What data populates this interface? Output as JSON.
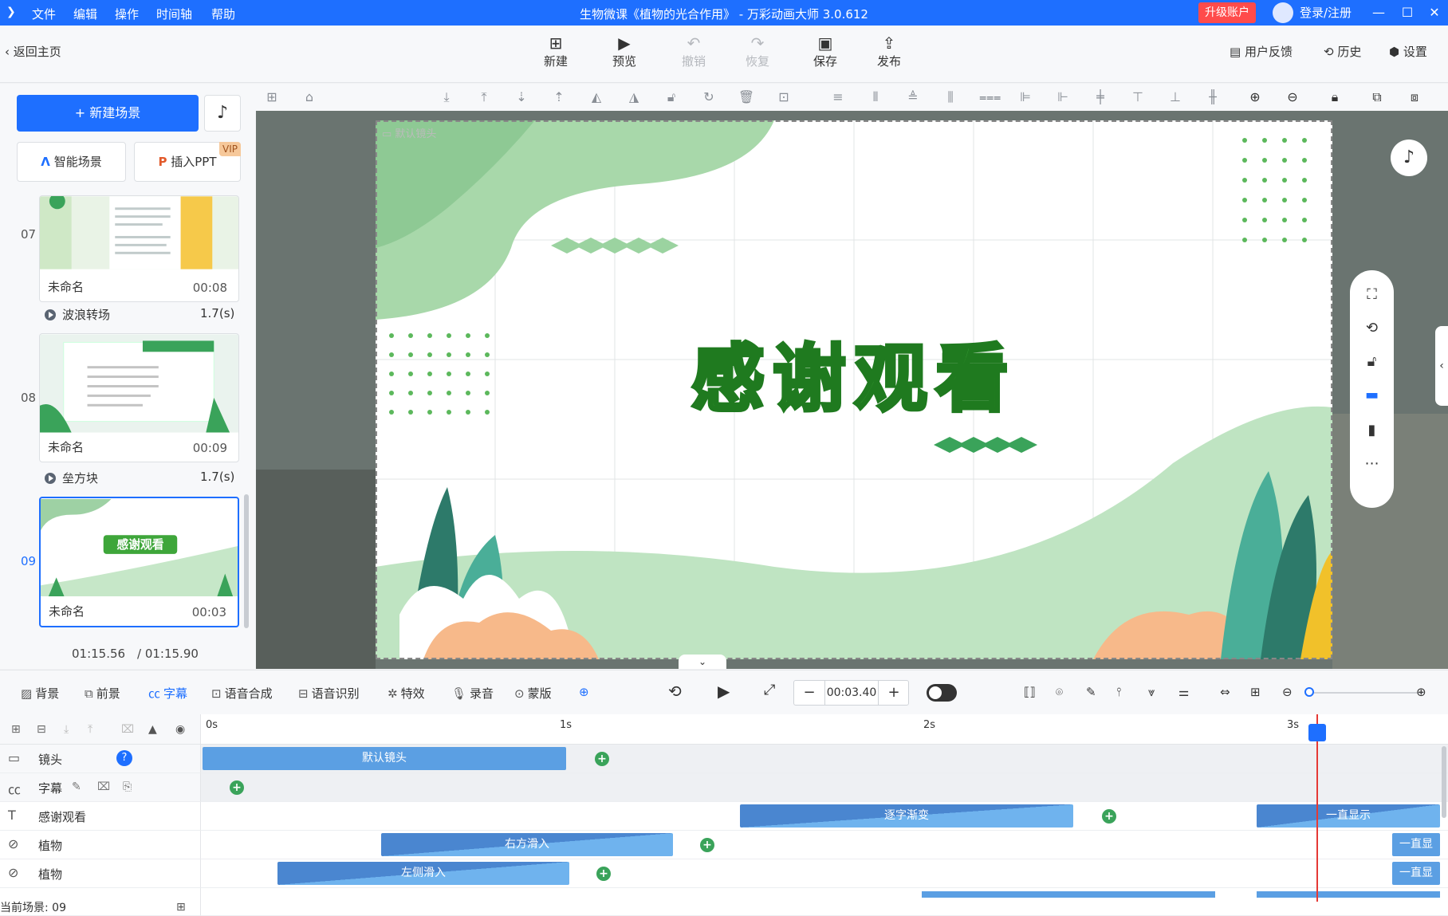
{
  "titlebar": {
    "menus": [
      "文件",
      "编辑",
      "操作",
      "时间轴",
      "帮助"
    ],
    "title": "生物微课《植物的光合作用》 - 万彩动画大师 3.0.612",
    "upgrade": "升级账户",
    "login": "登录/注册"
  },
  "toolbar": {
    "back": "返回主页",
    "new": "新建",
    "preview": "预览",
    "undo": "撤销",
    "redo": "恢复",
    "save": "保存",
    "publish": "发布",
    "feedback": "用户反馈",
    "history": "历史",
    "settings": "设置"
  },
  "left": {
    "new_scene": "新建场景",
    "smart_scene": "智能场景",
    "insert_ppt": "插入PPT",
    "vip": "VIP",
    "scenes": [
      {
        "num": "07",
        "name": "未命名",
        "dur": "00:08"
      },
      {
        "num": "08",
        "name": "未命名",
        "dur": "00:09"
      },
      {
        "num": "09",
        "name": "未命名",
        "dur": "00:03"
      }
    ],
    "transitions": [
      {
        "name": "波浪转场",
        "dur": "1.7(s)"
      },
      {
        "name": "垒方块",
        "dur": "1.7(s)"
      }
    ],
    "current_time": "01:15.56",
    "total_time": "/ 01:15.90"
  },
  "canvas": {
    "default_camera": "默认镜头",
    "thanks_text": "感谢观看"
  },
  "tl_toolbar": {
    "bg": "背景",
    "fg": "前景",
    "subtitle": "字幕",
    "tts": "语音合成",
    "asr": "语音识别",
    "effects": "特效",
    "record": "录音",
    "mask": "蒙版",
    "time": "00:03.40"
  },
  "timeline": {
    "ruler": [
      "0s",
      "1s",
      "2s",
      "3s"
    ],
    "tracks": [
      {
        "name": "镜头"
      },
      {
        "name": "字幕"
      },
      {
        "name": "感谢观看"
      },
      {
        "name": "植物"
      },
      {
        "name": "植物"
      }
    ],
    "clips": {
      "camera": "默认镜头",
      "thanks_1": "逐字渐变",
      "thanks_2": "一直显示",
      "plant1_1": "右方滑入",
      "plant1_2": "一直显",
      "plant2_1": "左侧滑入",
      "plant2_2": "一直显"
    },
    "current_scene": "当前场景: 09"
  }
}
